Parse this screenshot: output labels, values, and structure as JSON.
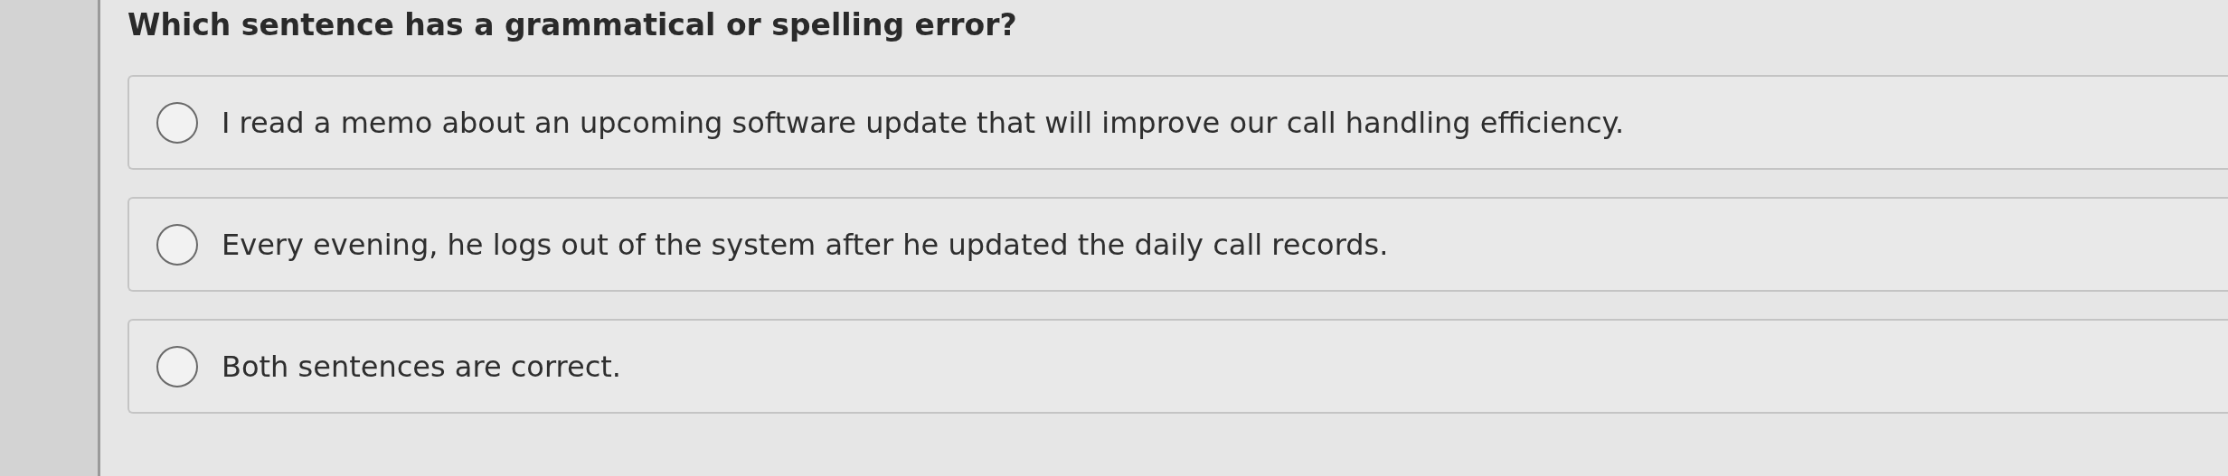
{
  "question": "Which sentence has a grammatical or spelling error?",
  "options": [
    {
      "text": "I read a memo about an upcoming software update that will improve our call handling efficiency.",
      "selected": false
    },
    {
      "text": "Every evening, he logs out of the system after he updated the daily call records.",
      "selected": false
    },
    {
      "text": "Both sentences are correct.",
      "selected": false
    }
  ]
}
